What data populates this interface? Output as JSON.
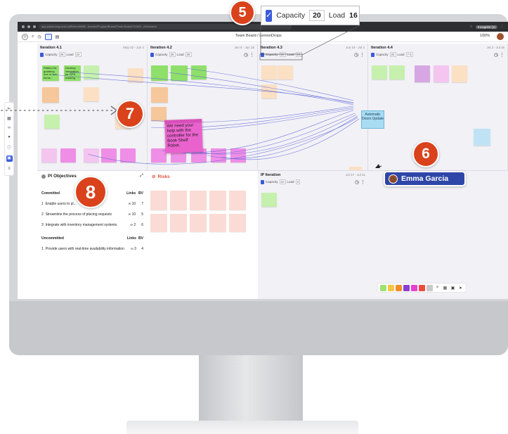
{
  "browser": {
    "url": "app.piplanning.io/cloud/Demo/b08ff...boards/ProgramBoard/Team-Board/7e1b0f...c0/session",
    "profile_label": "Incognito (1)"
  },
  "toolbar": {
    "board_title": "Team Board / LemonDrops",
    "zoom": "100%"
  },
  "iterations": [
    {
      "name": "Iteration 4.1",
      "dates": "May 22 - Jun 4",
      "capacity_label": "Capacity",
      "capacity": "28",
      "load_label": "Load",
      "load": "22"
    },
    {
      "name": "Iteration 4.2",
      "dates": "Jun 5 - Jun 18",
      "capacity_label": "Capacity",
      "capacity": "29",
      "load_label": "Load",
      "load": "28"
    },
    {
      "name": "Iteration 4.3",
      "dates": "Jun 19 - Jul 2",
      "capacity_label": "Capacity",
      "capacity": "20",
      "load_label": "Load",
      "load": "16"
    },
    {
      "name": "Iteration 4.4",
      "dates": "Jul 3 - Jul 16",
      "capacity_label": "Capacity",
      "capacity": "20",
      "load_label": "Load",
      "load": "7.5"
    }
  ],
  "ip_iteration": {
    "name": "IP Iteration",
    "dates": "Jul 17 - Jul 31",
    "capacity_label": "Capacity",
    "capacity": "10",
    "load_label": "Load",
    "load": "3"
  },
  "notes": {
    "n1": "Pattern for grabbing one or two Items...",
    "n2": "Develop integration for GPS tracking"
  },
  "highlight_note": "We need your help with the controller for the Book Shelf Robot.",
  "automatic_note": "Automatic Doors Update",
  "pi_objectives": {
    "title": "PI Objectives",
    "committed_label": "Committed",
    "uncommitted_label": "Uncommitted",
    "links_label": "Links",
    "bv_label": "BV",
    "committed": [
      {
        "num": "1",
        "text": "Enable users to pl...",
        "links": "10",
        "bv": "7"
      },
      {
        "num": "2",
        "text": "Streamline the process of placing requests",
        "links": "10",
        "bv": "5"
      },
      {
        "num": "3",
        "text": "Integrate with inventory management systems",
        "links": "2",
        "bv": "6"
      }
    ],
    "uncommitted": [
      {
        "num": "1",
        "text": "Provide users with real-time availability information",
        "links": "3",
        "bv": "4"
      }
    ]
  },
  "risks": {
    "title": "Risks"
  },
  "capacity_callout": {
    "capacity_label": "Capacity",
    "capacity": "20",
    "load_label": "Load",
    "load": "16"
  },
  "user": {
    "name": "Emma Garcia"
  },
  "callouts": {
    "c5": "5",
    "c6": "6",
    "c7": "7",
    "c8": "8"
  },
  "icons": {
    "link": "∞",
    "clock": "◷",
    "more": "⋮"
  },
  "palette": [
    "#9be36f",
    "#f6c543",
    "#f28c28",
    "#8a3fd1",
    "#e63fd1",
    "#ef4a3c",
    "#c9c9c9"
  ],
  "colors": {
    "accent": "#3b5bdb",
    "callout": "#d9421b",
    "chip": "#2e46a8"
  }
}
